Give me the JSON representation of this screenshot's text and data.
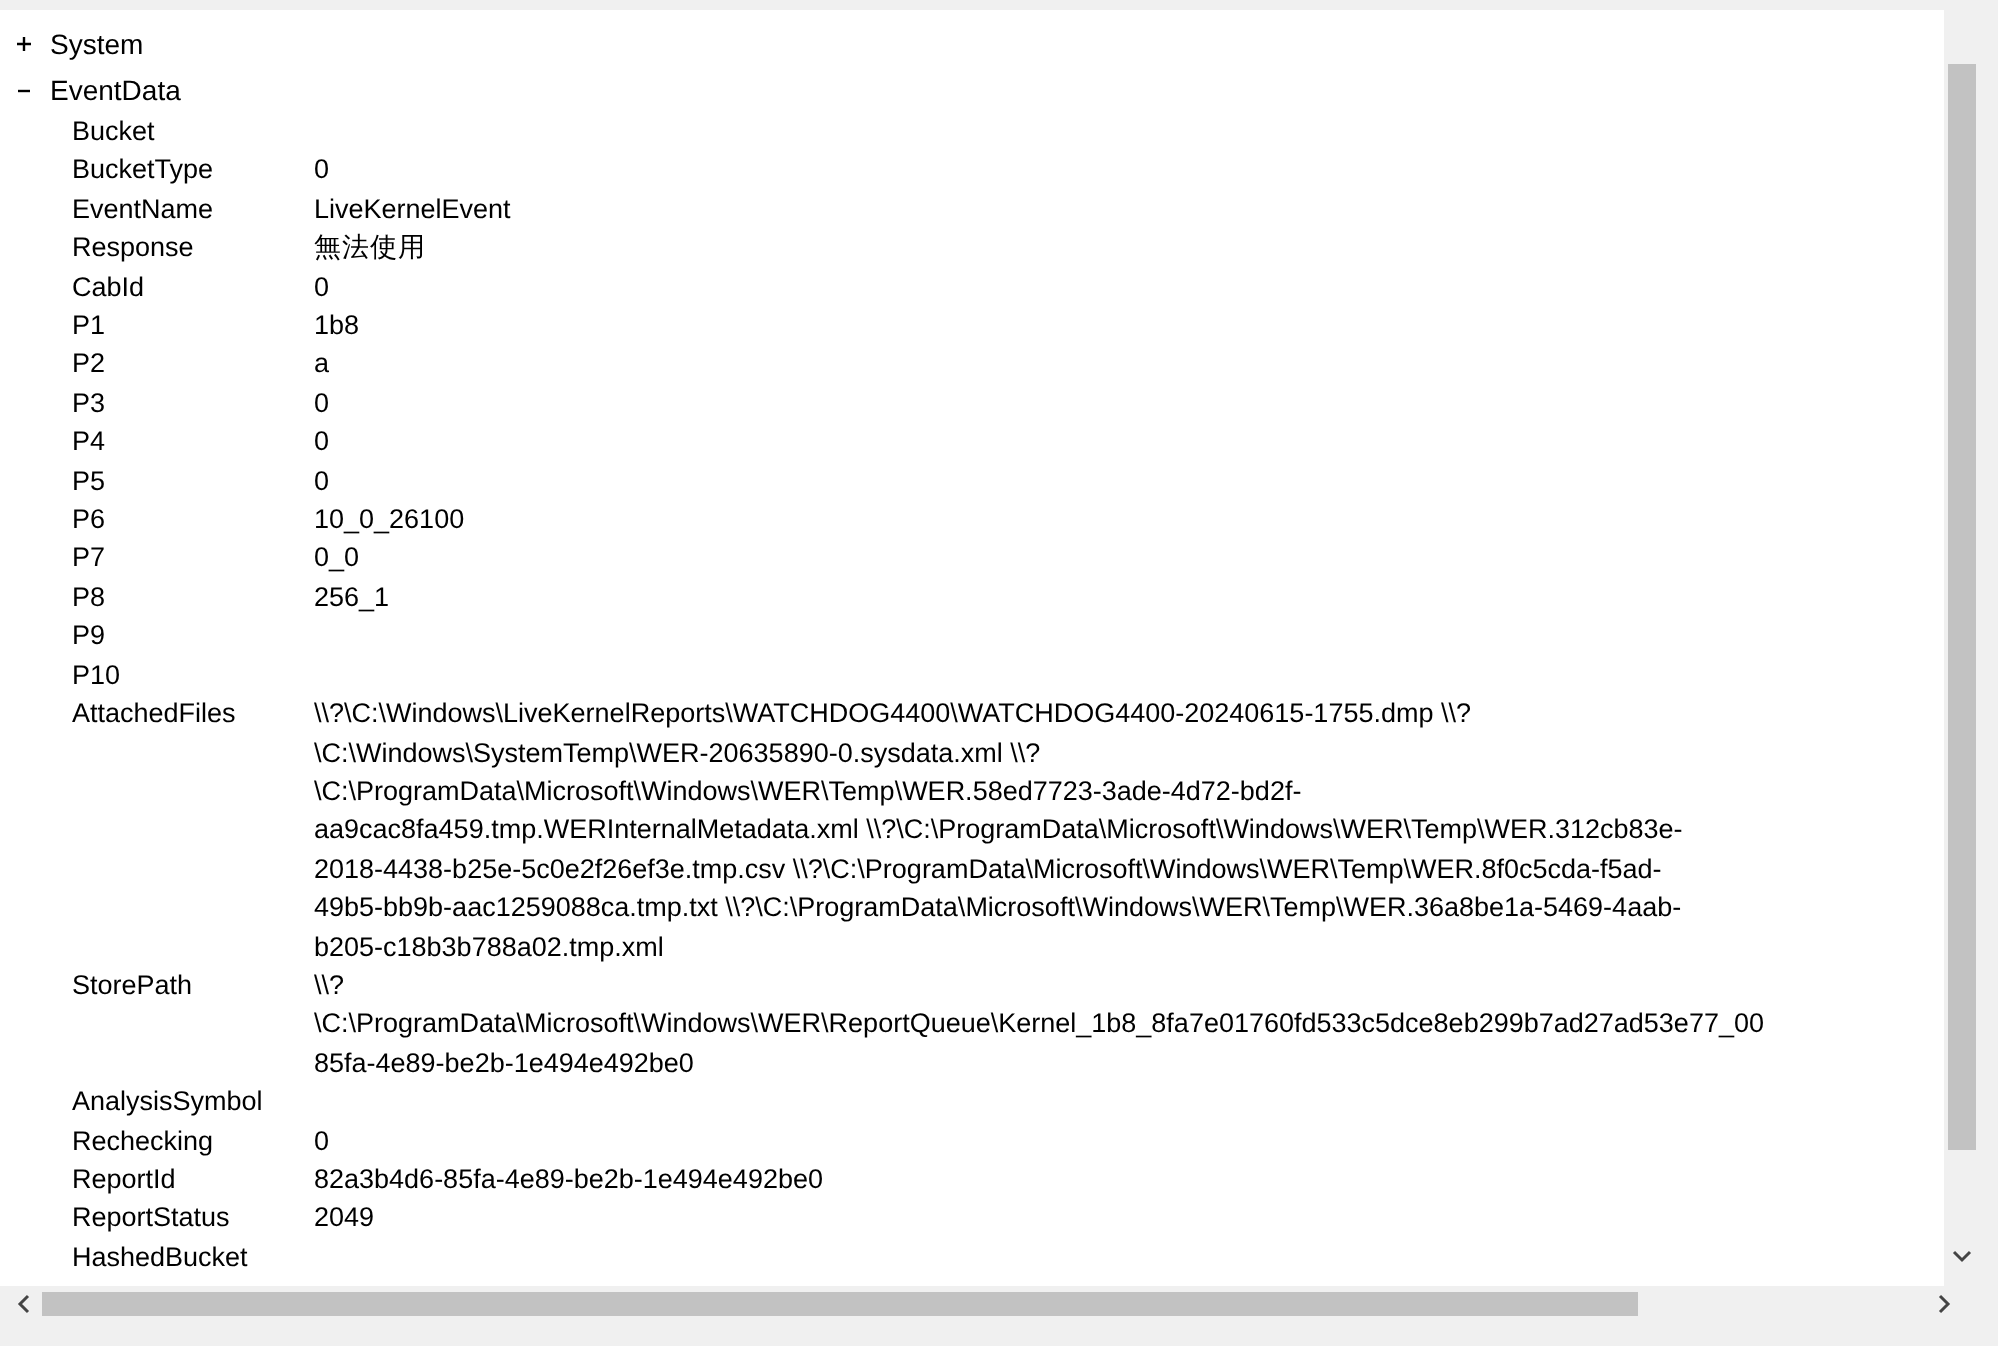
{
  "tree": [
    {
      "label": "System",
      "expanded": false
    },
    {
      "label": "EventData",
      "expanded": true,
      "children": [
        {
          "name": "Bucket"
        },
        {
          "name": "BucketType",
          "value": "0"
        },
        {
          "name": "EventName",
          "value": "LiveKernelEvent"
        },
        {
          "name": "Response",
          "value": "無法使用"
        },
        {
          "name": "CabId",
          "value": "0"
        },
        {
          "name": "P1",
          "value": "1b8"
        },
        {
          "name": "P2",
          "value": "a"
        },
        {
          "name": "P3",
          "value": "0"
        },
        {
          "name": "P4",
          "value": "0"
        },
        {
          "name": "P5",
          "value": "0"
        },
        {
          "name": "P6",
          "value": "10_0_26100"
        },
        {
          "name": "P7",
          "value": "0_0"
        },
        {
          "name": "P8",
          "value": "256_1"
        },
        {
          "name": "P9"
        },
        {
          "name": "P10"
        },
        {
          "name": "AttachedFiles",
          "value": "\\\\?\\C:\\Windows\\LiveKernelReports\\WATCHDOG4400\\WATCHDOG4400-20240615-1755.dmp \\\\?\n\\C:\\Windows\\SystemTemp\\WER-20635890-0.sysdata.xml \\\\?\n\\C:\\ProgramData\\Microsoft\\Windows\\WER\\Temp\\WER.58ed7723-3ade-4d72-bd2f-\naa9cac8fa459.tmp.WERInternalMetadata.xml \\\\?\\C:\\ProgramData\\Microsoft\\Windows\\WER\\Temp\\WER.312cb83e-\n2018-4438-b25e-5c0e2f26ef3e.tmp.csv \\\\?\\C:\\ProgramData\\Microsoft\\Windows\\WER\\Temp\\WER.8f0c5cda-f5ad-\n49b5-bb9b-aac1259088ca.tmp.txt \\\\?\\C:\\ProgramData\\Microsoft\\Windows\\WER\\Temp\\WER.36a8be1a-5469-4aab-\nb205-c18b3b788a02.tmp.xml"
        },
        {
          "name": "StorePath",
          "value": "\\\\?\n\\C:\\ProgramData\\Microsoft\\Windows\\WER\\ReportQueue\\Kernel_1b8_8fa7e01760fd533c5dce8eb299b7ad27ad53e77_00\n85fa-4e89-be2b-1e494e492be0"
        },
        {
          "name": "AnalysisSymbol"
        },
        {
          "name": "Rechecking",
          "value": "0"
        },
        {
          "name": "ReportId",
          "value": "82a3b4d6-85fa-4e89-be2b-1e494e492be0"
        },
        {
          "name": "ReportStatus",
          "value": "2049"
        },
        {
          "name": "HashedBucket"
        }
      ]
    }
  ]
}
